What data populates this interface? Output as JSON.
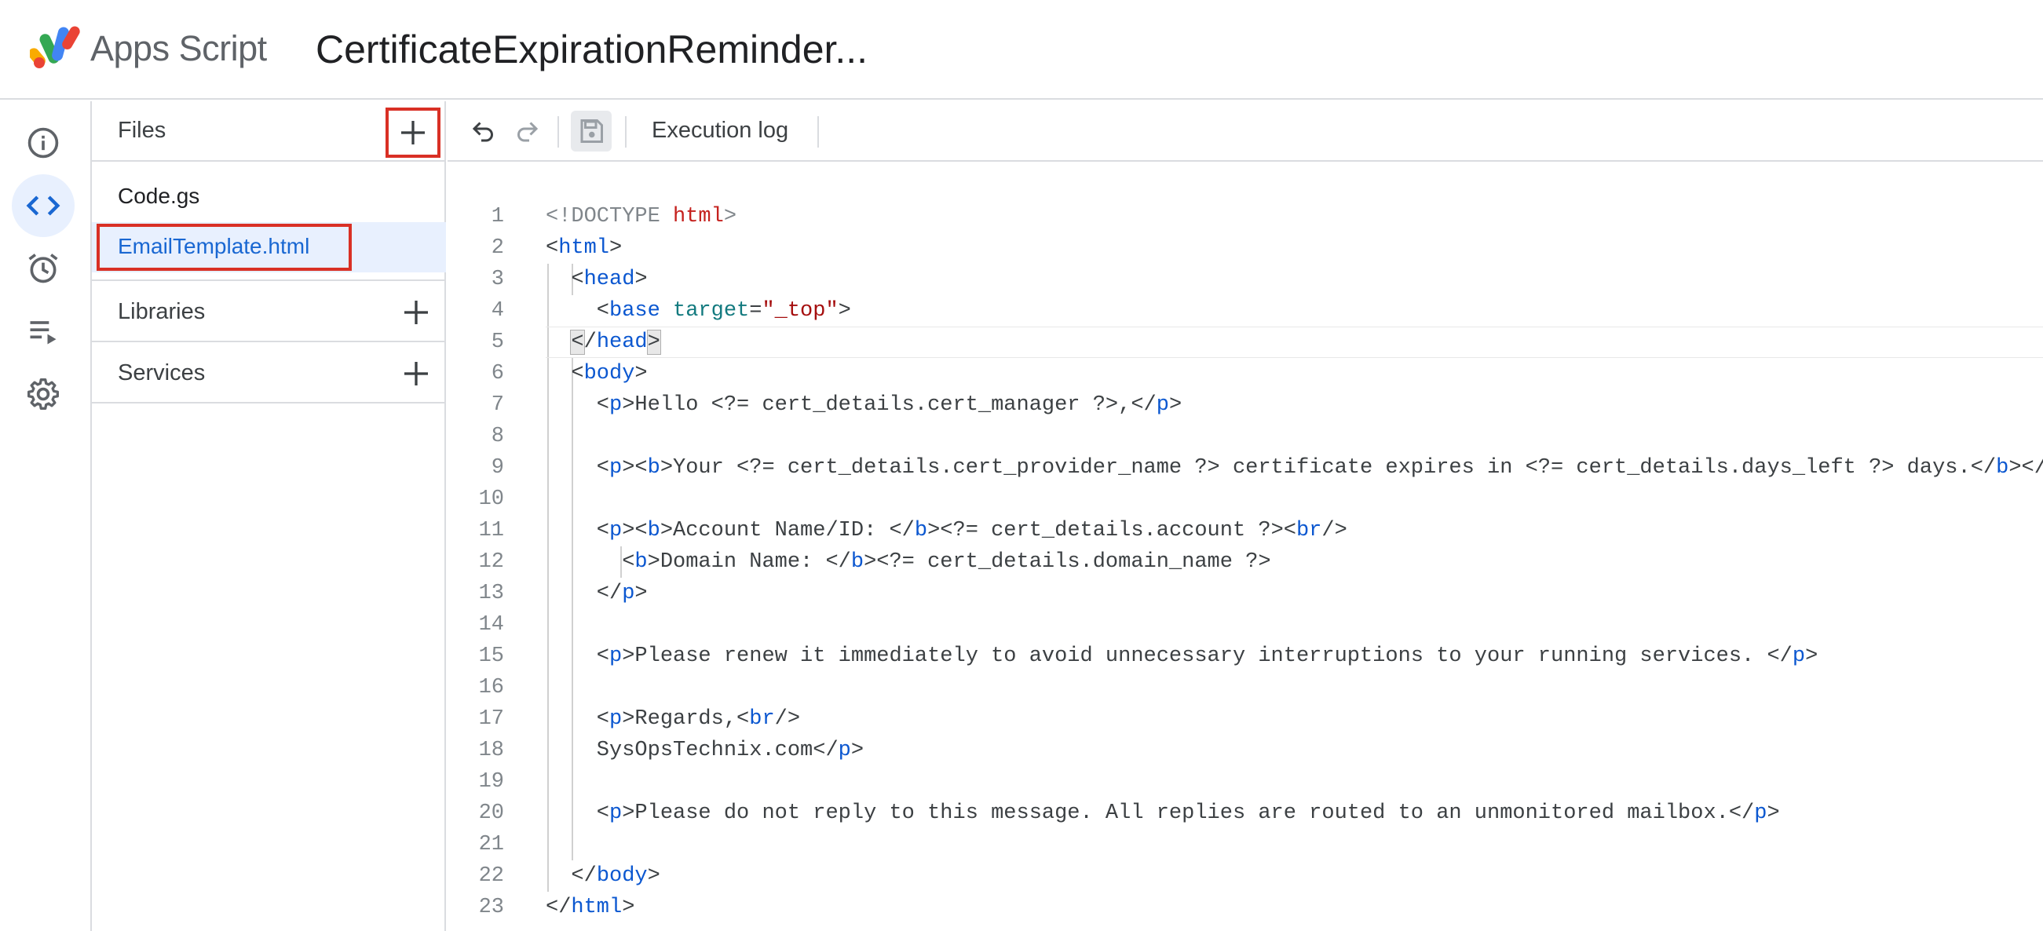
{
  "header": {
    "app_name": "Apps Script",
    "project_title": "CertificateExpirationReminder..."
  },
  "rail": {
    "items": [
      {
        "name": "overview",
        "icon": "info-icon"
      },
      {
        "name": "editor",
        "icon": "code-icon",
        "active": true
      },
      {
        "name": "triggers",
        "icon": "alarm-clock-icon"
      },
      {
        "name": "executions",
        "icon": "playlist-icon"
      },
      {
        "name": "settings",
        "icon": "gear-icon"
      }
    ]
  },
  "panel": {
    "files_label": "Files",
    "files": [
      {
        "name": "Code.gs",
        "selected": false
      },
      {
        "name": "EmailTemplate.html",
        "selected": true
      }
    ],
    "libraries_label": "Libraries",
    "services_label": "Services"
  },
  "toolbar": {
    "execution_log_label": "Execution log"
  },
  "colors": {
    "accent": "#1967d2",
    "selected_bg": "#e8f0fe",
    "highlight_red": "#d93025",
    "tag_blue": "#0b57d0"
  },
  "editor": {
    "lines": [
      {
        "n": "1",
        "tokens": [
          [
            "doctype",
            "<!DOCTYPE "
          ],
          [
            "kw",
            "html"
          ],
          [
            "doctype",
            ">"
          ]
        ]
      },
      {
        "n": "2",
        "tokens": [
          [
            "plain",
            "<"
          ],
          [
            "tag",
            "html"
          ],
          [
            "plain",
            ">"
          ]
        ]
      },
      {
        "n": "3",
        "tokens": [
          [
            "plain",
            "  <"
          ],
          [
            "tag",
            "head"
          ],
          [
            "plain",
            ">"
          ]
        ]
      },
      {
        "n": "4",
        "tokens": [
          [
            "plain",
            "    <"
          ],
          [
            "tag",
            "base"
          ],
          [
            "plain",
            " "
          ],
          [
            "attr",
            "target"
          ],
          [
            "plain",
            "="
          ],
          [
            "str",
            "\"_top\""
          ],
          [
            "plain",
            ">"
          ]
        ]
      },
      {
        "n": "5",
        "tokens": [
          [
            "plain",
            "  "
          ],
          [
            "bracket",
            "<"
          ],
          [
            "plain",
            "/"
          ],
          [
            "tag",
            "head"
          ],
          [
            "bracket",
            ">"
          ]
        ]
      },
      {
        "n": "6",
        "tokens": [
          [
            "plain",
            "  <"
          ],
          [
            "tag",
            "body"
          ],
          [
            "plain",
            ">"
          ]
        ]
      },
      {
        "n": "7",
        "tokens": [
          [
            "plain",
            "    <"
          ],
          [
            "tag",
            "p"
          ],
          [
            "plain",
            ">Hello <?= cert_details.cert_manager ?>,</"
          ],
          [
            "tag",
            "p"
          ],
          [
            "plain",
            ">"
          ]
        ]
      },
      {
        "n": "8",
        "tokens": []
      },
      {
        "n": "9",
        "tokens": [
          [
            "plain",
            "    <"
          ],
          [
            "tag",
            "p"
          ],
          [
            "plain",
            "><"
          ],
          [
            "tag",
            "b"
          ],
          [
            "plain",
            ">Your <?= cert_details.cert_provider_name ?> certificate expires in <?= cert_details.days_left ?> days.</"
          ],
          [
            "tag",
            "b"
          ],
          [
            "plain",
            "></"
          ],
          [
            "tag",
            "p"
          ],
          [
            "plain",
            ">"
          ]
        ]
      },
      {
        "n": "10",
        "tokens": []
      },
      {
        "n": "11",
        "tokens": [
          [
            "plain",
            "    <"
          ],
          [
            "tag",
            "p"
          ],
          [
            "plain",
            "><"
          ],
          [
            "tag",
            "b"
          ],
          [
            "plain",
            ">Account Name/ID: </"
          ],
          [
            "tag",
            "b"
          ],
          [
            "plain",
            "><?= cert_details.account ?><"
          ],
          [
            "tag",
            "br"
          ],
          [
            "plain",
            "/>"
          ]
        ]
      },
      {
        "n": "12",
        "tokens": [
          [
            "plain",
            "      <"
          ],
          [
            "tag",
            "b"
          ],
          [
            "plain",
            ">Domain Name: </"
          ],
          [
            "tag",
            "b"
          ],
          [
            "plain",
            "><?= cert_details.domain_name ?>"
          ]
        ]
      },
      {
        "n": "13",
        "tokens": [
          [
            "plain",
            "    </"
          ],
          [
            "tag",
            "p"
          ],
          [
            "plain",
            ">"
          ]
        ]
      },
      {
        "n": "14",
        "tokens": []
      },
      {
        "n": "15",
        "tokens": [
          [
            "plain",
            "    <"
          ],
          [
            "tag",
            "p"
          ],
          [
            "plain",
            ">Please renew it immediately to avoid unnecessary interruptions to your running services. </"
          ],
          [
            "tag",
            "p"
          ],
          [
            "plain",
            ">"
          ]
        ]
      },
      {
        "n": "16",
        "tokens": []
      },
      {
        "n": "17",
        "tokens": [
          [
            "plain",
            "    <"
          ],
          [
            "tag",
            "p"
          ],
          [
            "plain",
            ">Regards,<"
          ],
          [
            "tag",
            "br"
          ],
          [
            "plain",
            "/>"
          ]
        ]
      },
      {
        "n": "18",
        "tokens": [
          [
            "plain",
            "    SysOpsTechnix.com</"
          ],
          [
            "tag",
            "p"
          ],
          [
            "plain",
            ">"
          ]
        ]
      },
      {
        "n": "19",
        "tokens": []
      },
      {
        "n": "20",
        "tokens": [
          [
            "plain",
            "    <"
          ],
          [
            "tag",
            "p"
          ],
          [
            "plain",
            ">Please do not reply to this message. All replies are routed to an unmonitored mailbox.</"
          ],
          [
            "tag",
            "p"
          ],
          [
            "plain",
            ">"
          ]
        ]
      },
      {
        "n": "21",
        "tokens": []
      },
      {
        "n": "22",
        "tokens": [
          [
            "plain",
            "  </"
          ],
          [
            "tag",
            "body"
          ],
          [
            "plain",
            ">"
          ]
        ]
      },
      {
        "n": "23",
        "tokens": [
          [
            "plain",
            "</"
          ],
          [
            "tag",
            "html"
          ],
          [
            "plain",
            ">"
          ]
        ]
      }
    ]
  }
}
